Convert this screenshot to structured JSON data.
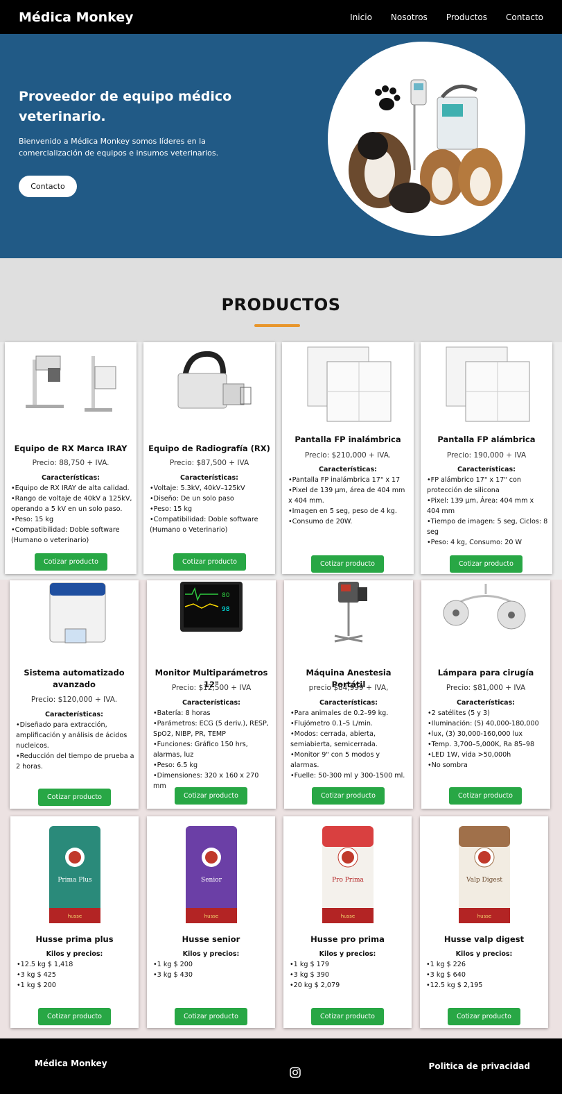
{
  "nav": {
    "brand": "Médica Monkey",
    "links": [
      "Inicio",
      "Nosotros",
      "Productos",
      "Contacto"
    ]
  },
  "hero": {
    "title": "Proveedor de equipo médico veterinario.",
    "text": "Bienvenido a Médica Monkey somos líderes en la comercialización de equipos e insumos veterinarios.",
    "button": "Contacto",
    "image_icon": "paw-icon"
  },
  "products": {
    "title": "PRODUCTOS",
    "cta_label": "Cotizar producto",
    "row1": [
      {
        "title": "Equipo de RX Marca IRAY",
        "price": "Precio: 88,750 + IVA.",
        "subtitle": "Características:",
        "items": [
          "Equipo de RX IRAY de alta calidad.",
          "Rango de voltaje de 40kV a 125kV, operando a 5 kV en un solo paso.",
          "Peso: 15 kg",
          "Compatibilidad: Doble software (Humano o veterinario)"
        ]
      },
      {
        "title": "Equipo de Radiografía (RX)",
        "price": "Precio: $87,500 + IVA",
        "subtitle": "Características:",
        "items": [
          "Voltaje: 5.3kV, 40kV–125kV",
          "Diseño: De un solo paso",
          "Peso: 15 kg",
          "Compatibilidad: Doble software (Humano o Veterinario)"
        ]
      },
      {
        "title": "Pantalla FP inalámbrica",
        "price": "Precio: $210,000 + IVA.",
        "subtitle": "Características:",
        "items": [
          "Pantalla FP inalámbrica 17\" x 17",
          "Pixel de 139 µm, área de 404 mm x 404 mm.",
          "Imagen en 5 seg, peso de 4 kg.",
          "Consumo de 20W."
        ]
      },
      {
        "title": "Pantalla FP alámbrica",
        "price": "Precio: 190,000 + IVA",
        "subtitle": "Características:",
        "items": [
          "FP alámbrico 17\" x 17\" con protección de silicona",
          "Pixel: 139 µm, Área: 404 mm x 404 mm",
          "Tiempo de imagen: 5 seg, Ciclos: 8 seg",
          "Peso: 4 kg, Consumo: 20 W"
        ]
      }
    ],
    "row2": [
      {
        "title": "Sistema automatizado avanzado",
        "price": "Precio: $120,000 + IVA.",
        "subtitle": "Características:",
        "items": [
          "Diseñado para extracción, amplificación y análisis de ácidos nucleicos.",
          "Reducción del tiempo de prueba a 2 horas."
        ]
      },
      {
        "title": "Monitor Multiparámetros 12\"",
        "price": "Precio: $12,500 + IVA",
        "subtitle": "Características:",
        "items": [
          "Batería: 8 horas",
          "Parámetros: ECG (5 deriv.), RESP, SpO2, NIBP, PR, TEMP",
          "Funciones: Gráfico 150 hrs, alarmas, luz",
          "Peso: 6.5 kg",
          "Dimensiones: 320 x 160 x 270 mm"
        ]
      },
      {
        "title": "Máquina Anestesia Portátil",
        "price": "precio $84,999 + IVA,",
        "subtitle": "Características:",
        "items": [
          "Para animales de 0.2–99 kg.",
          "Flujómetro 0.1–5 L/min.",
          "Modos: cerrada, abierta, semiabierta, semicerrada.",
          "Monitor 9\" con 5 modos y alarmas.",
          "Fuelle: 50-300 ml y 300-1500 ml."
        ]
      },
      {
        "title": "Lámpara para cirugía",
        "price": "Precio: $81,000 + IVA",
        "subtitle": "Características:",
        "items": [
          "2 satélites (5 y 3)",
          "Iluminación: (5) 40,000-180,000",
          "lux, (3) 30,000-160,000 lux",
          "Temp. 3,700–5,000K, Ra 85–98",
          "LED 1W, vida >50,000h",
          "No sombra"
        ]
      }
    ],
    "row3": [
      {
        "title": "Husse prima plus",
        "subtitle": "Kilos y precios:",
        "bag_label": "Prima Plus",
        "brand": "husse",
        "items": [
          "12.5 kg $ 1,418",
          "3 kg $ 425",
          "1 kg $ 200"
        ]
      },
      {
        "title": "Husse senior",
        "subtitle": "Kilos y precios:",
        "bag_label": "Senior",
        "brand": "husse",
        "items": [
          "1 kg $ 200",
          "3 kg $ 430"
        ]
      },
      {
        "title": "Husse pro prima",
        "subtitle": "Kilos y precios:",
        "bag_label": "Pro Prima",
        "brand": "husse",
        "items": [
          "1 kg $ 179",
          "3 kg $ 390",
          "20 kg $ 2,079"
        ]
      },
      {
        "title": "Husse valp digest",
        "subtitle": "Kilos y precios:",
        "bag_label": "Valp Digest",
        "brand": "husse",
        "items": [
          "1 kg $ 226",
          "3 kg $ 640",
          "12.5 kg $ 2,195"
        ]
      }
    ]
  },
  "footer": {
    "brand": "Médica Monkey",
    "policy": "Politica de privacidad",
    "social_icon": "instagram-icon"
  },
  "colors": {
    "nav": "#000000",
    "hero": "#215a86",
    "accent": "#e8962c",
    "cta": "#28a745"
  }
}
